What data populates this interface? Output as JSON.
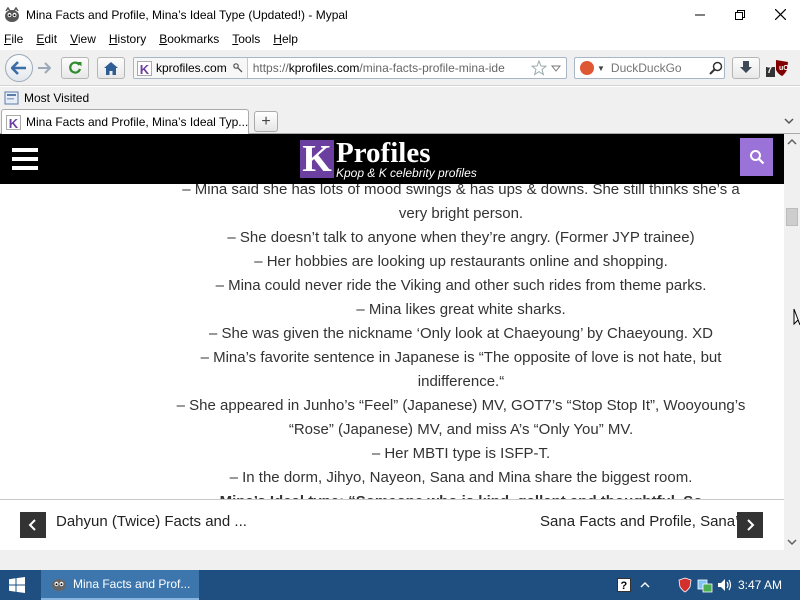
{
  "window": {
    "title": "Mina Facts and Profile, Mina’s Ideal Type (Updated!) - Mypal"
  },
  "menu": [
    {
      "label": "File",
      "key": "F",
      "rest": "ile"
    },
    {
      "label": "Edit",
      "key": "E",
      "rest": "dit"
    },
    {
      "label": "View",
      "key": "V",
      "rest": "iew"
    },
    {
      "label": "History",
      "key": "H",
      "rest": "istory"
    },
    {
      "label": "Bookmarks",
      "key": "B",
      "rest": "ookmarks"
    },
    {
      "label": "Tools",
      "key": "T",
      "rest": "ools"
    },
    {
      "label": "Help",
      "key": "H",
      "rest": "elp"
    }
  ],
  "navbar": {
    "site_domain": "kprofiles.com",
    "url_scheme": "https://",
    "url_host": "kprofiles.com",
    "url_path": "/mina-facts-profile-mina-ide",
    "search_engine": "DuckDuckGo",
    "search_placeholder": "DuckDuckGo",
    "addon_badge": "7"
  },
  "bookmarks": {
    "most_visited": "Most Visited"
  },
  "tabs": {
    "active_label": "Mina Facts and Profile, Mina’s Ideal Typ...",
    "new_tab": "+"
  },
  "site": {
    "logo_k": "K",
    "logo_name": "Profiles",
    "logo_tagline": "Kpop & K celebrity profiles"
  },
  "article_lines": [
    "– Mina said she has lots of mood swings & has ups & downs. She still thinks she’s a",
    "very bright person.",
    "– She doesn’t talk to anyone when they’re angry. (Former JYP trainee)",
    "– Her hobbies are looking up restaurants online and shopping.",
    "– Mina could never ride the Viking and other such rides from theme parks.",
    "– Mina likes great white sharks.",
    "– She was given the nickname ‘Only look at Chaeyoung’ by Chaeyoung. XD",
    "– Mina’s favorite sentence in Japanese is “The opposite of love is not hate, but",
    "indifference.“",
    "– She appeared in Junho’s “Feel” (Japanese) MV, GOT7’s “Stop Stop It”, Wooyoung’s",
    "“Rose” (Japanese) MV, and miss A’s “Only You” MV.",
    "– Her MBTI type is ISFP-T.",
    "– In the dorm, Jihyo, Nayeon, Sana and Mina share the biggest room.",
    "Mina’s Ideal type: “Someone who is kind, gallant and thoughtful. So"
  ],
  "post_nav": {
    "prev": "Dahyun (Twice) Facts and ...",
    "next": "Sana Facts and Profile, Sana’s"
  },
  "taskbar": {
    "app_label": "Mina Facts and Prof...",
    "time": "3:47 AM"
  },
  "colors": {
    "brand_purple": "#6b3fa0",
    "search_button": "#9b72d8",
    "taskbar": "#1f4f80"
  }
}
